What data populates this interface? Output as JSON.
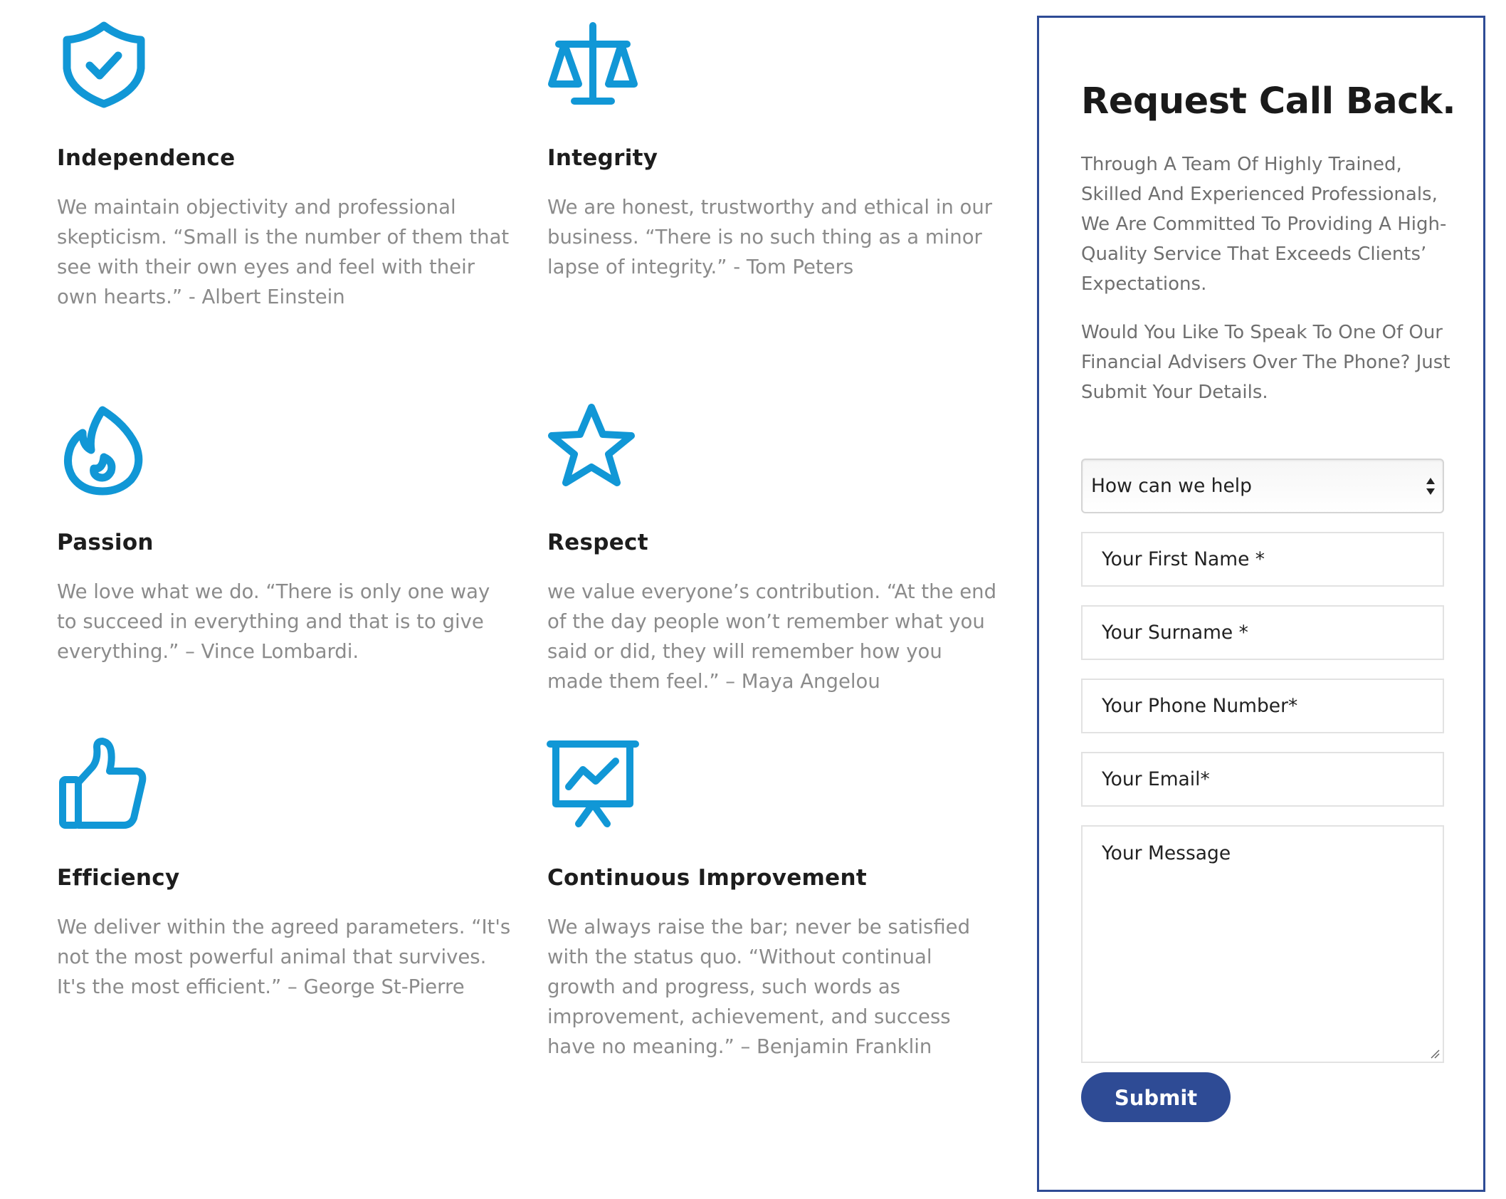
{
  "brand_colors": {
    "icon_blue": "#1197d6",
    "panel_border": "#2e4b95",
    "button": "#2e4b95",
    "body_text": "#8b8b8b"
  },
  "values": [
    {
      "icon": "shield-check-icon",
      "title": "Independence",
      "text": "We maintain objectivity and professional skepticism. “Small is the number of them that see with their own eyes and feel with their own hearts.” - Albert Einstein"
    },
    {
      "icon": "scales-icon",
      "title": "Integrity",
      "text": "We are honest, trustworthy and ethical in our business. “There is no such thing as a minor lapse of integrity.” - Tom Peters"
    },
    {
      "icon": "flame-icon",
      "title": "Passion",
      "text": "We love what we do. “There is only one way to succeed in everything and that is to give everything.” – Vince Lombardi."
    },
    {
      "icon": "star-icon",
      "title": "Respect",
      "text": "we value everyone’s contribution. “At the end of the day people won’t remember what you said or did, they will remember how you made them feel.” – Maya Angelou"
    },
    {
      "icon": "thumbs-up-icon",
      "title": "Efficiency",
      "text": "We deliver within the agreed parameters. “It's not the most powerful animal that survives. It's the most efficient.” – George St-Pierre"
    },
    {
      "icon": "presentation-chart-icon",
      "title": "Continuous Improvement",
      "text": "We always raise the bar; never be satisfied with the status quo. “Without continual growth and progress, such words as improvement, achievement, and success have no meaning.” – Benjamin Franklin"
    }
  ],
  "form": {
    "title": "Request Call Back.",
    "intro_1": "Through A Team Of Highly Trained, Skilled And Experienced Professionals, We Are Committed To Providing A High-Quality Service That Exceeds Clients’ Expectations.",
    "intro_2": "Would You Like To Speak To One Of Our Financial Advisers Over The Phone? Just Submit Your Details.",
    "help_select": "How can we help",
    "first_name": "Your First Name *",
    "surname": "Your Surname *",
    "phone": "Your Phone Number*",
    "email": "Your Email*",
    "message": "Your Message",
    "submit_label": "Submit"
  }
}
